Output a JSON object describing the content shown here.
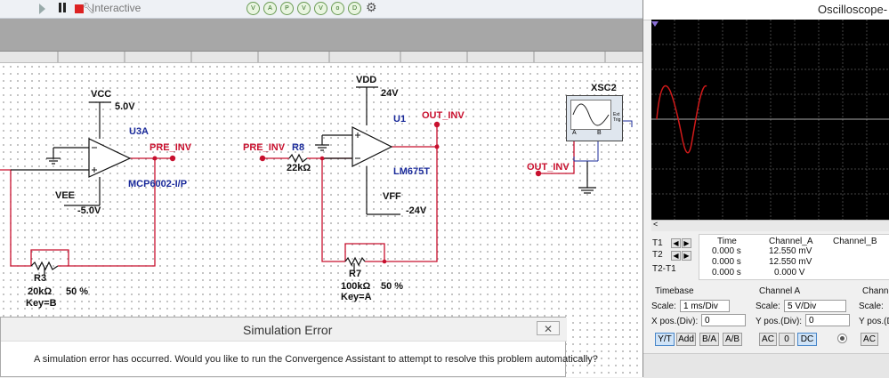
{
  "toolbar": {
    "interactive_label": "Interactive"
  },
  "schematic": {
    "vcc": "VCC",
    "vcc_value": "5.0V",
    "vee": "VEE",
    "vee_value": "-5.0V",
    "u3a": "U3A",
    "u3a_part": "MCP6002-I/P",
    "pre_inv_1": "PRE_INV",
    "pre_inv_2": "PRE_INV",
    "r3": "R3",
    "r3_value": "20kΩ",
    "r3_pct": "50 %",
    "r3_key": "Key=B",
    "r8": "R8",
    "r8_value": "22kΩ",
    "vdd": "VDD",
    "vdd_value": "24V",
    "vff": "VFF",
    "vff_value": "-24V",
    "u1": "U1",
    "u1_part": "LM675T",
    "out_inv_1": "OUT_INV",
    "out_inv_2": "OUT_INV",
    "r7": "R7",
    "r7_value": "100kΩ",
    "r7_pct": "50 %",
    "r7_key": "Key=A",
    "xsc2": "XSC2",
    "ext_trig": "Ext Trig",
    "ch_a": "A",
    "ch_b": "B"
  },
  "scope": {
    "title": "Oscilloscope-",
    "table": {
      "headers": [
        "Time",
        "Channel_A",
        "Channel_B"
      ],
      "rows": [
        {
          "label": "T1",
          "time": "0.000 s",
          "cha": "12.550 mV",
          "chb": ""
        },
        {
          "label": "T2",
          "time": "0.000 s",
          "cha": "12.550 mV",
          "chb": ""
        },
        {
          "label": "T2-T1",
          "time": "0.000 s",
          "cha": "0.000 V",
          "chb": ""
        }
      ]
    },
    "timebase": {
      "title": "Timebase",
      "scale_label": "Scale:",
      "scale": "1 ms/Div",
      "xpos_label": "X pos.(Div):",
      "xpos": "0",
      "buttons": [
        "Y/T",
        "Add",
        "B/A",
        "A/B"
      ]
    },
    "channel_a": {
      "title": "Channel A",
      "scale_label": "Scale:",
      "scale": "5 V/Div",
      "ypos_label": "Y pos.(Div):",
      "ypos": "0",
      "buttons": [
        "AC",
        "0",
        "DC"
      ]
    },
    "channel_b": {
      "title": "Channe",
      "scale_label": "Scale:",
      "ypos_label": "Y pos.(D",
      "buttons": [
        "AC"
      ]
    },
    "trace_color": "#d11a1a"
  },
  "dialog": {
    "title": "Simulation Error",
    "message": "A simulation error has occurred. Would you like to run the Convergence Assistant to attempt to resolve this problem automatically?"
  }
}
